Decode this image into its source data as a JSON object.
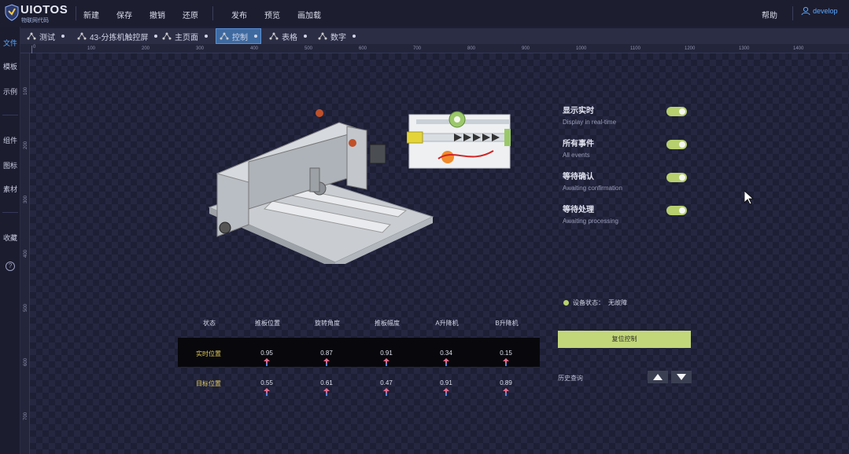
{
  "app": {
    "brand": "UIOTOS",
    "brand_sub": "物联网代码",
    "menu": [
      "新建",
      "保存",
      "撤销",
      "还原",
      "发布",
      "预览",
      "画加载"
    ],
    "help": "帮助",
    "user": "develop"
  },
  "sidebar": {
    "items": [
      "文件",
      "模板",
      "示例",
      "组件",
      "图标",
      "素材",
      "收藏"
    ],
    "help_icon": "?"
  },
  "tabs": [
    {
      "label": "测试",
      "active": false
    },
    {
      "label": "43-分拣机触控屏",
      "active": false
    },
    {
      "label": "主页面",
      "active": false
    },
    {
      "label": "控制",
      "active": true
    },
    {
      "label": "表格",
      "active": false
    },
    {
      "label": "数字",
      "active": false
    }
  ],
  "ruler_top": [
    "0",
    "100",
    "200",
    "300",
    "400",
    "500",
    "600",
    "700",
    "800",
    "900",
    "1000",
    "1100",
    "1200",
    "1300",
    "1400"
  ],
  "ruler_left": [
    "100",
    "200",
    "300",
    "400",
    "500",
    "600",
    "700"
  ],
  "panel": {
    "toggles": [
      {
        "title": "显示实时",
        "sub": "Display in real-time",
        "on": true
      },
      {
        "title": "所有事件",
        "sub": "All events",
        "on": true
      },
      {
        "title": "等待确认",
        "sub": "Awaiting confirmation",
        "on": true
      },
      {
        "title": "等待处理",
        "sub": "Awaiting processing",
        "on": true
      }
    ],
    "status_label": "设备状态：",
    "status_value": "无故障",
    "reset_button": "复位控制",
    "history_label": "历史查询"
  },
  "table": {
    "headers": [
      "状态",
      "推板位置",
      "旋转角度",
      "推板幅度",
      "A升降机",
      "B升降机"
    ],
    "rows": [
      {
        "label": "实时位置",
        "values": [
          "0.95",
          "0.87",
          "0.91",
          "0.34",
          "0.15"
        ]
      },
      {
        "label": "目标位置",
        "values": [
          "0.55",
          "0.61",
          "0.47",
          "0.91",
          "0.89"
        ]
      }
    ]
  },
  "colors": {
    "accent_green": "#b7cf6e",
    "accent_blue": "#5aa8ff",
    "row_label": "#e0c95a"
  }
}
